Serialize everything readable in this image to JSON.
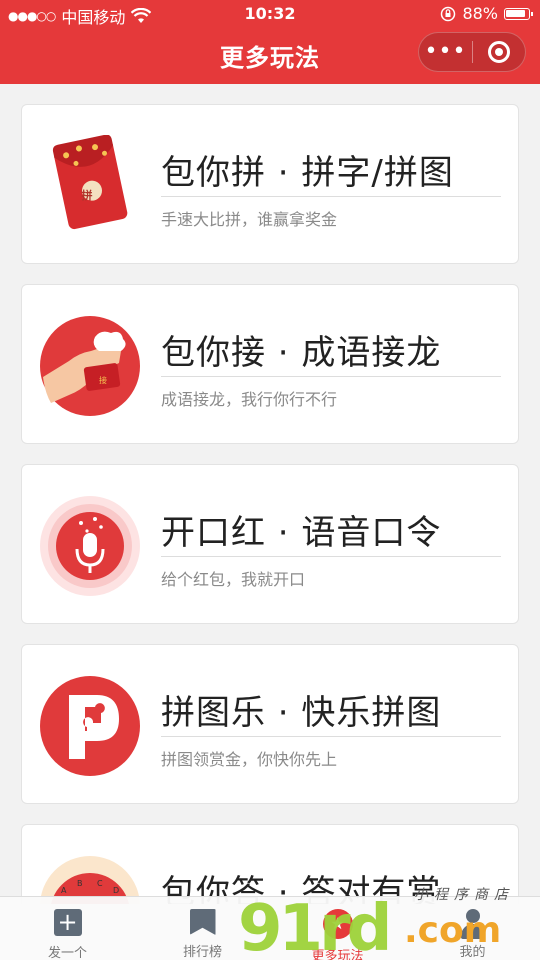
{
  "status_bar": {
    "signal": "●●●○○",
    "carrier": "中国移动",
    "wifi_icon": "wifi-icon",
    "time": "10:32",
    "rotation_lock_icon": "rotation-lock-icon",
    "battery_percent": "88%",
    "battery_level": 0.88
  },
  "nav": {
    "title": "更多玩法",
    "more_glyph": "•••",
    "more_icon": "more-icon",
    "close_icon": "target-icon"
  },
  "games": [
    {
      "title": "包你拼 · 拼字/拼图",
      "desc": "手速大比拼，谁赢拿奖金",
      "badge": "拼"
    },
    {
      "title": "包你接 · 成语接龙",
      "desc": "成语接龙，我行你行不行",
      "badge": "接"
    },
    {
      "title": "开口红 · 语音口令",
      "desc": "给个红包，我就开口"
    },
    {
      "title": "拼图乐 · 快乐拼图",
      "desc": "拼图领赏金，你快你先上"
    },
    {
      "title": "包你答 · 答对有赏",
      "badges": [
        "A",
        "B",
        "C",
        "D"
      ]
    }
  ],
  "tabs": [
    {
      "label": "发一个",
      "glyph": "+",
      "icon": "plus-icon"
    },
    {
      "label": "排行榜",
      "icon": "bookmark-icon"
    },
    {
      "label": "更多玩法",
      "glyph": "★",
      "icon": "star-icon"
    },
    {
      "label": "我的",
      "icon": "user-icon"
    }
  ],
  "watermark": {
    "main": "91rd",
    "com": ".com",
    "sub": "小程序商店"
  },
  "colors": {
    "brand_red": "#e5393a",
    "watermark_green": "#9ed23a",
    "watermark_orange": "#f0a52a"
  }
}
